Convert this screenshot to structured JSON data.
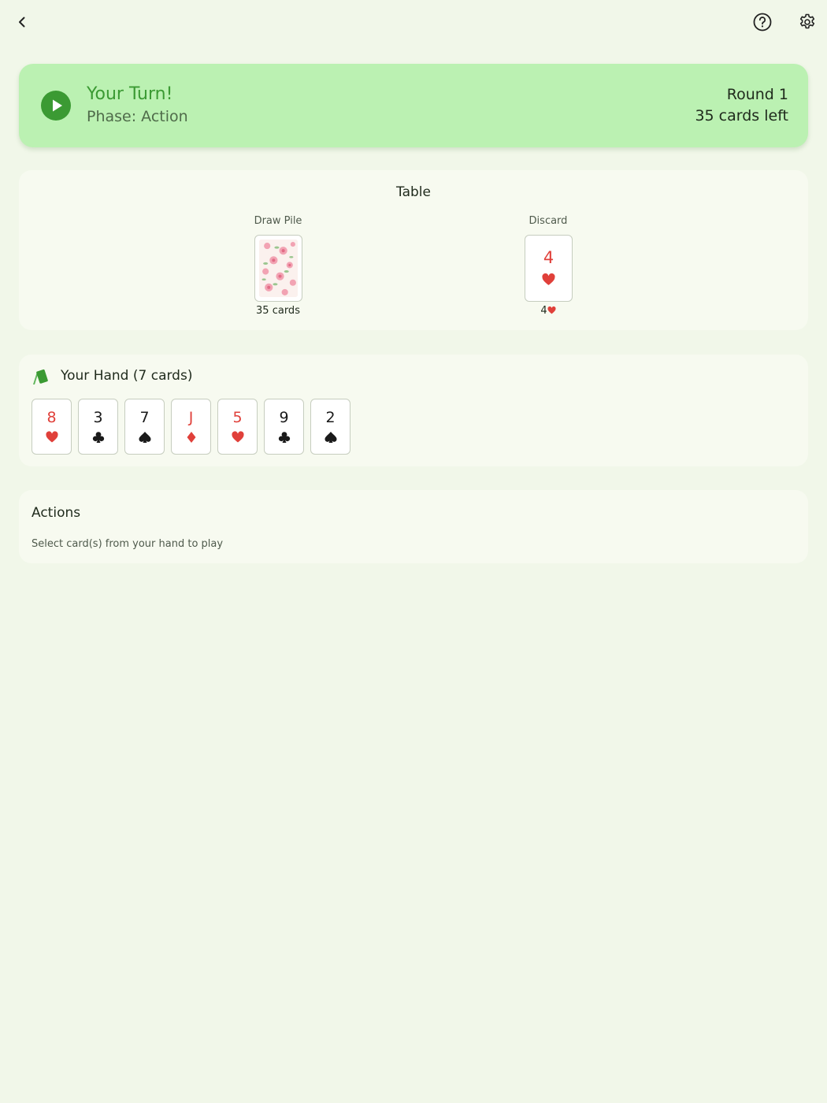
{
  "header": {
    "back_icon": "chevron-left-icon",
    "help_icon": "help-circle-icon",
    "settings_icon": "gear-icon"
  },
  "turn_banner": {
    "title": "Your Turn!",
    "phase": "Phase: Action",
    "round": "Round 1",
    "cards_left": "35 cards left",
    "icon": "play-circle-icon",
    "accent_color": "#3b9a33",
    "background_color": "#bbf1b2"
  },
  "table": {
    "title": "Table",
    "draw_pile": {
      "label": "Draw Pile",
      "count_text": "35 cards",
      "card_back": "floral-card-back"
    },
    "discard": {
      "label": "Discard",
      "top_card": {
        "rank": "4",
        "suit": "hearts",
        "color": "red"
      },
      "caption_rank": "4",
      "caption_suit": "hearts"
    }
  },
  "hand": {
    "title": "Your Hand (7 cards)",
    "icon": "cards-icon",
    "cards": [
      {
        "rank": "8",
        "suit": "hearts",
        "color": "red"
      },
      {
        "rank": "3",
        "suit": "clubs",
        "color": "black"
      },
      {
        "rank": "7",
        "suit": "spades",
        "color": "black"
      },
      {
        "rank": "J",
        "suit": "diamonds",
        "color": "red"
      },
      {
        "rank": "5",
        "suit": "hearts",
        "color": "red"
      },
      {
        "rank": "9",
        "suit": "clubs",
        "color": "black"
      },
      {
        "rank": "2",
        "suit": "spades",
        "color": "black"
      }
    ]
  },
  "actions": {
    "title": "Actions",
    "hint": "Select card(s) from your hand to play"
  },
  "colors": {
    "background": "#f1f7e9",
    "panel": "#f7faf0",
    "red_suit": "#e0403a",
    "black_suit": "#1a1a1a"
  }
}
